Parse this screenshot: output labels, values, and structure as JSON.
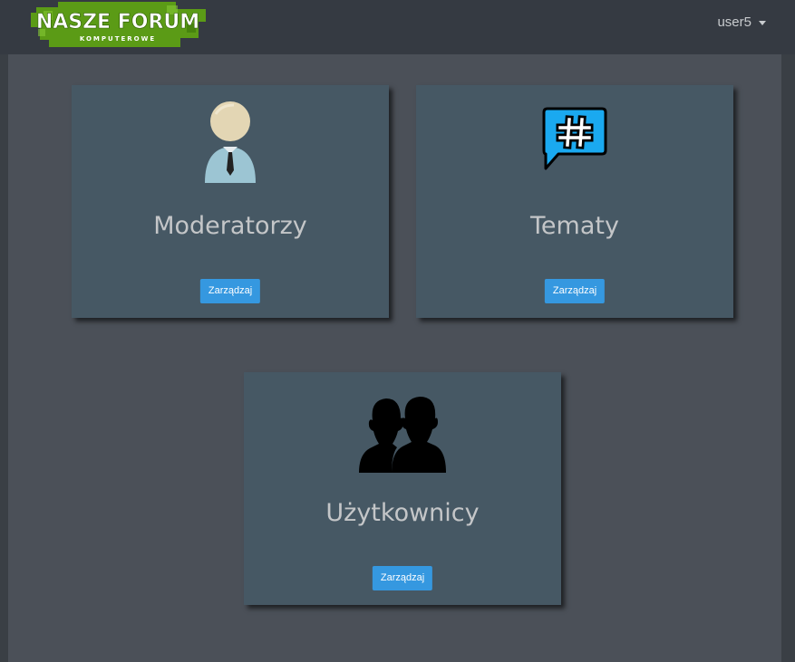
{
  "header": {
    "logo_title": "NASZE FORUM",
    "logo_subtitle": "KOMPUTEROWE",
    "user": "user5"
  },
  "cards": [
    {
      "title": "Moderatorzy",
      "button": "Zarządzaj",
      "icon": "moderator-icon"
    },
    {
      "title": "Tematy",
      "button": "Zarządzaj",
      "icon": "hashtag-chat-icon"
    },
    {
      "title": "Użytkownicy",
      "button": "Zarządzaj",
      "icon": "users-icon"
    }
  ],
  "colors": {
    "navbar": "#353a42",
    "background": "#4b5058",
    "card": "#465864",
    "button": "#3598e0",
    "logo_green": "#6aa51e",
    "chat_blue": "#1aa9f0"
  }
}
